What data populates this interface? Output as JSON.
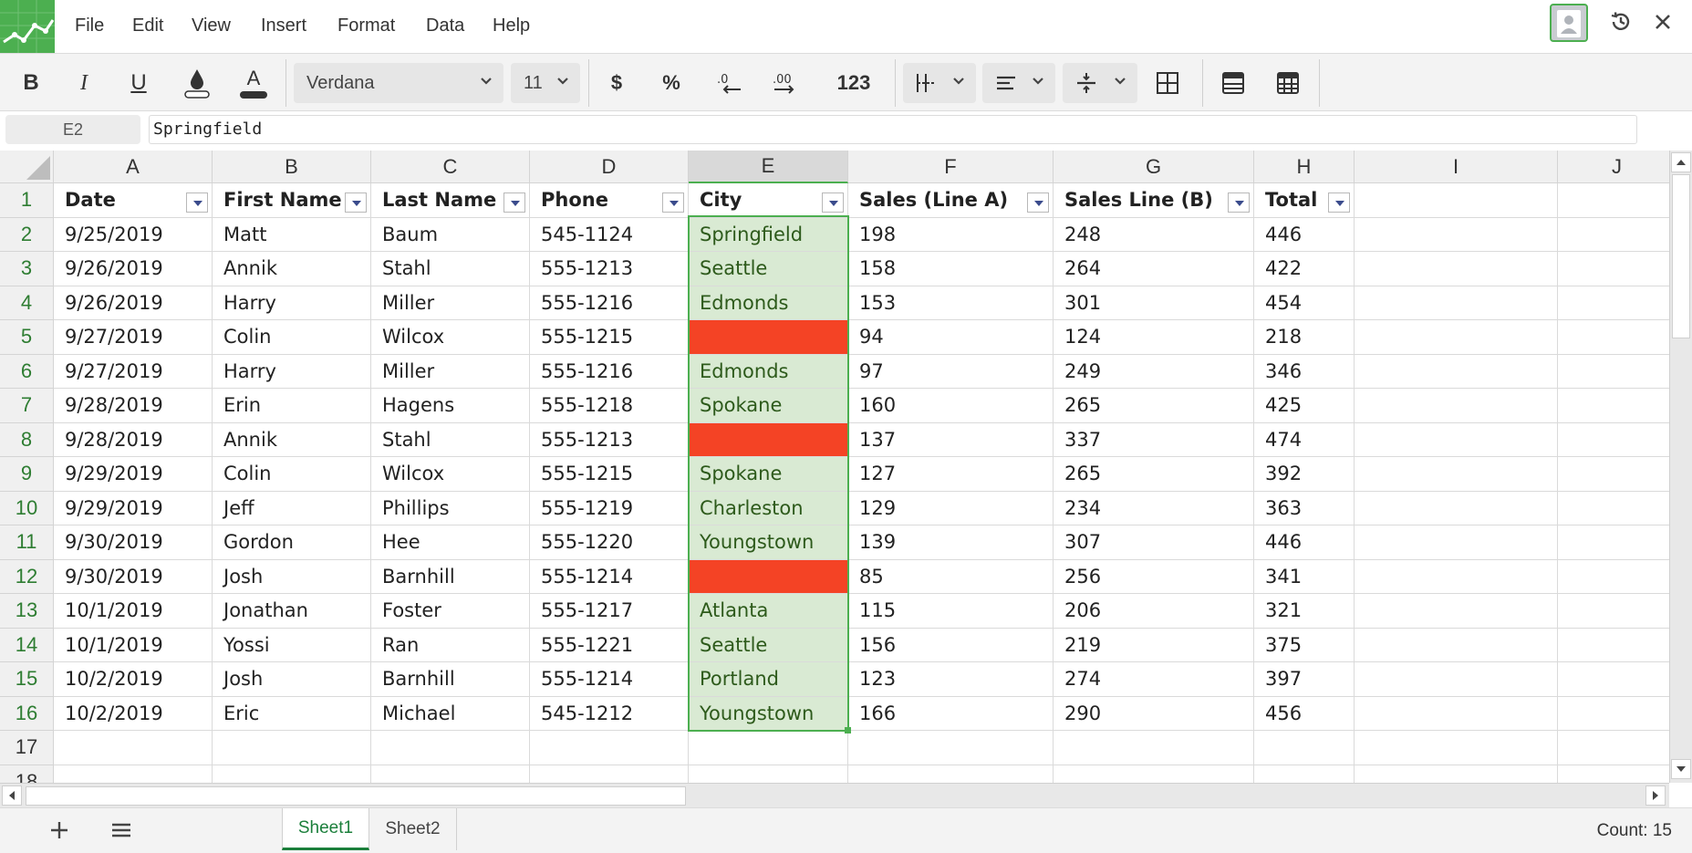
{
  "menu": {
    "items": [
      "File",
      "Edit",
      "View",
      "Insert",
      "Format",
      "Data",
      "Help"
    ]
  },
  "toolbar": {
    "bold": "B",
    "italic": "I",
    "underline": "U",
    "font_color_glyph": "A",
    "font_name": "Verdana",
    "font_size": "11",
    "currency": "$",
    "percent": "%",
    "number_format": "123"
  },
  "formula_bar": {
    "cell_ref": "E2",
    "value": "Springfield"
  },
  "grid": {
    "columns": [
      "A",
      "B",
      "C",
      "D",
      "E",
      "F",
      "G",
      "H",
      "I",
      "J"
    ],
    "row_numbers": [
      "1",
      "2",
      "3",
      "4",
      "5",
      "6",
      "7",
      "8",
      "9",
      "10",
      "11",
      "12",
      "13",
      "14",
      "15",
      "16",
      "17",
      "18"
    ],
    "headers": [
      "Date",
      "First Name",
      "Last Name",
      "Phone",
      "City",
      "Sales (Line A)",
      "Sales Line (B)",
      "Total"
    ],
    "rows": [
      [
        "9/25/2019",
        "Matt",
        "Baum",
        "545-1124",
        "Springfield",
        "198",
        "248",
        "446"
      ],
      [
        "9/26/2019",
        "Annik",
        "Stahl",
        "555-1213",
        "Seattle",
        "158",
        "264",
        "422"
      ],
      [
        "9/26/2019",
        "Harry",
        "Miller",
        "555-1216",
        "Edmonds",
        "153",
        "301",
        "454"
      ],
      [
        "9/27/2019",
        "Colin",
        "Wilcox",
        "555-1215",
        "",
        "94",
        "124",
        "218"
      ],
      [
        "9/27/2019",
        "Harry",
        "Miller",
        "555-1216",
        "Edmonds",
        "97",
        "249",
        "346"
      ],
      [
        "9/28/2019",
        "Erin",
        "Hagens",
        "555-1218",
        "Spokane",
        "160",
        "265",
        "425"
      ],
      [
        "9/28/2019",
        "Annik",
        "Stahl",
        "555-1213",
        "",
        "137",
        "337",
        "474"
      ],
      [
        "9/29/2019",
        "Colin",
        "Wilcox",
        "555-1215",
        "Spokane",
        "127",
        "265",
        "392"
      ],
      [
        "9/29/2019",
        "Jeff",
        "Phillips",
        "555-1219",
        "Charleston",
        "129",
        "234",
        "363"
      ],
      [
        "9/30/2019",
        "Gordon",
        "Hee",
        "555-1220",
        "Youngstown",
        "139",
        "307",
        "446"
      ],
      [
        "9/30/2019",
        "Josh",
        "Barnhill",
        "555-1214",
        "",
        "85",
        "256",
        "341"
      ],
      [
        "10/1/2019",
        "Jonathan",
        "Foster",
        "555-1217",
        "Atlanta",
        "115",
        "206",
        "321"
      ],
      [
        "10/1/2019",
        "Yossi",
        "Ran",
        "555-1221",
        "Seattle",
        "156",
        "219",
        "375"
      ],
      [
        "10/2/2019",
        "Josh",
        "Barnhill",
        "555-1214",
        "Portland",
        "123",
        "274",
        "397"
      ],
      [
        "10/2/2019",
        "Eric",
        "Michael",
        "545-1212",
        "Youngstown",
        "166",
        "290",
        "456"
      ]
    ],
    "selected_column": "E",
    "highlight_colors": {
      "selection": "#4caf50",
      "city_fill": "#d9ead3",
      "empty_city_fill": "#f44325"
    }
  },
  "sheets": {
    "tabs": [
      "Sheet1",
      "Sheet2"
    ],
    "active": "Sheet1"
  },
  "status": {
    "count": "Count: 15"
  },
  "icons": [
    "logo-icon",
    "avatar-icon",
    "history-icon",
    "close-icon",
    "fill-color-icon",
    "decrease-decimal-icon",
    "increase-decimal-icon",
    "borders-icon",
    "align-icon",
    "valign-icon",
    "merge-icon",
    "table-icon",
    "table-style-icon",
    "add-sheet-icon",
    "sheet-list-icon",
    "filter-icon"
  ]
}
